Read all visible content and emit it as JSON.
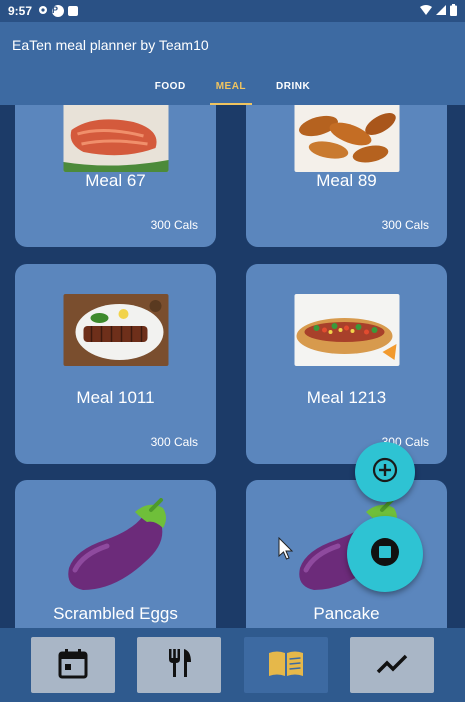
{
  "status_bar": {
    "time": "9:57"
  },
  "app": {
    "title": "EaTen meal planner by Team10"
  },
  "tabs": [
    {
      "label": "FOOD",
      "active": false
    },
    {
      "label": "MEAL",
      "active": true
    },
    {
      "label": "DRINK",
      "active": false
    }
  ],
  "meals": [
    {
      "name": "Meal 67",
      "cals": "300 Cals",
      "image": "salmon"
    },
    {
      "name": "Meal 89",
      "cals": "300 Cals",
      "image": "chicken-tenders"
    },
    {
      "name": "Meal 1011",
      "cals": "300 Cals",
      "image": "ribs"
    },
    {
      "name": "Meal 1213",
      "cals": "300 Cals",
      "image": "hotdog"
    },
    {
      "name": "Scrambled Eggs",
      "cals": "",
      "image": "eggplant-emoji"
    },
    {
      "name": "Pancake",
      "cals": "",
      "image": "eggplant-emoji"
    }
  ],
  "colors": {
    "app_bar": "#3d6aa2",
    "card": "#5b86bd",
    "background": "#1c3b68",
    "accent": "#f0c45f",
    "fab": "#2ec3d3"
  },
  "fabs": {
    "add_icon": "add-circle-icon",
    "stop_icon": "stop-icon"
  },
  "bottom_nav": [
    {
      "icon": "calendar-icon",
      "active": false
    },
    {
      "icon": "restaurant-icon",
      "active": false
    },
    {
      "icon": "book-icon",
      "active": true
    },
    {
      "icon": "trending-up-icon",
      "active": false
    }
  ]
}
